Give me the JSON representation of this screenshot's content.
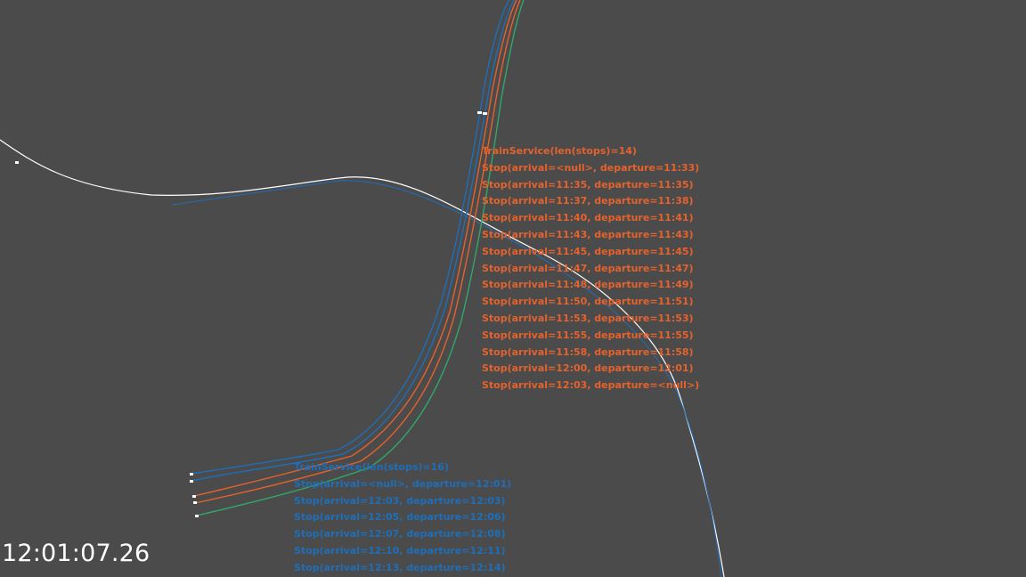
{
  "colors": {
    "background": "#4b4b4b",
    "orange": "#e5622c",
    "blue": "#1f6eb8",
    "green": "#2fa86a",
    "white": "#ffffff"
  },
  "orange_service": {
    "header": "TrainService(len(stops)=14)",
    "lines": [
      "Stop(arrival=<null>, departure=11:33)",
      "Stop(arrival=11:35, departure=11:35)",
      "Stop(arrival=11:37, departure=11:38)",
      "Stop(arrival=11:40, departure=11:41)",
      "Stop(arrival=11:43, departure=11:43)",
      "Stop(arrival=11:45, departure=11:45)",
      "Stop(arrival=11:47, departure=11:47)",
      "Stop(arrival=11:48, departure=11:49)",
      "Stop(arrival=11:50, departure=11:51)",
      "Stop(arrival=11:53, departure=11:53)",
      "Stop(arrival=11:55, departure=11:55)",
      "Stop(arrival=11:58, departure=11:58)",
      "Stop(arrival=12:00, departure=12:01)",
      "Stop(arrival=12:03, departure=<null>)"
    ]
  },
  "blue_service": {
    "header": "TrainService(len(stops)=16)",
    "lines": [
      "Stop(arrival=<null>, departure=12:01)",
      "Stop(arrival=12:03, departure=12:03)",
      "Stop(arrival=12:05, departure=12:06)",
      "Stop(arrival=12:07, departure=12:08)",
      "Stop(arrival=12:10, departure=12:11)",
      "Stop(arrival=12:13, departure=12:14)"
    ]
  },
  "clock": "12:01:07.26"
}
